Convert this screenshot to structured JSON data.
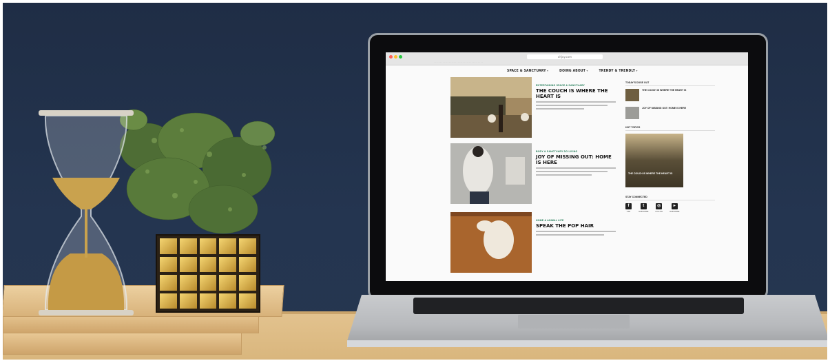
{
  "browser": {
    "url": "ohjoy.com",
    "bookmarks": "· · · · · · · · · · · · · · · · · · · · · · · · · · · · · · · · · · · · · · ·"
  },
  "site_nav": [
    "SPACE & SANCTUARY",
    "DOING ABOUT",
    "TRENDY & TRENDLY"
  ],
  "posts": [
    {
      "kicker": "ENTERTAINING  SPACE & SANCTUARY",
      "title": "THE COUCH IS WHERE THE HEART IS"
    },
    {
      "kicker": "BODY & SANCTUARY  DO LIVING",
      "title": "JOY OF MISSING OUT: HOME IS HERE"
    },
    {
      "kicker": "HOME & ANIMAL LIFE",
      "title": "SPEAK THE POP HAIR"
    }
  ],
  "sidebar": {
    "todays_heading": "TODAY'S DOSE OUT",
    "todays_items": [
      "THE COUCH IS WHERE THE HEART IS",
      "JOY OF MISSING OUT: HOME IS HERE"
    ],
    "hot_heading": "HOT TOPICS",
    "hot_caption": "THE COUCH IS WHERE THE HEART IS",
    "connect_heading": "STAY CONNECTED",
    "social": [
      {
        "icon": "facebook-icon",
        "glyph": "f",
        "label": "LIKE"
      },
      {
        "icon": "twitter-icon",
        "glyph": "t",
        "label": "SUBSCRIBE"
      },
      {
        "icon": "instagram-icon",
        "glyph": "◎",
        "label": "FOLLOW"
      },
      {
        "icon": "youtube-icon",
        "glyph": "▸",
        "label": "SUBSCRIBE"
      }
    ]
  },
  "colors": {
    "wall": "#243550",
    "desk": "#dfbd86",
    "accent": "#1f7a55"
  }
}
